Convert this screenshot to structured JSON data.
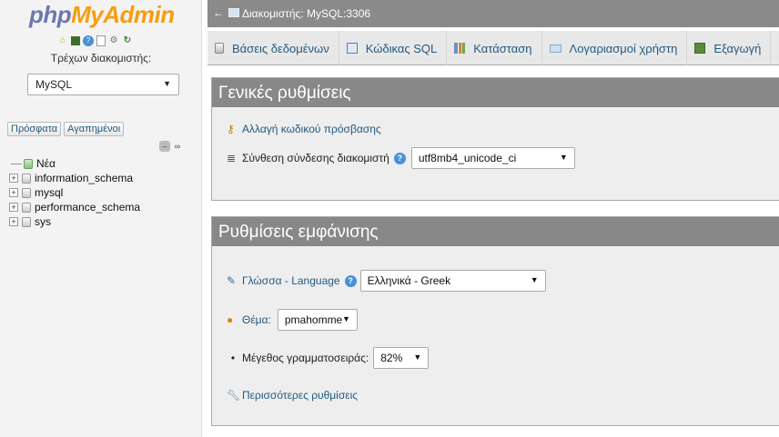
{
  "sidebar": {
    "logo_part1": "php",
    "logo_part2": "MyAdmin",
    "server_label": "Τρέχων διακομιστής:",
    "server_value": "MySQL",
    "recent_label": "Πρόσφατα",
    "favorites_label": "Αγαπημένοι",
    "tree": [
      {
        "label": "Νέα"
      },
      {
        "label": "information_schema"
      },
      {
        "label": "mysql"
      },
      {
        "label": "performance_schema"
      },
      {
        "label": "sys"
      }
    ]
  },
  "topbar": {
    "back_arrow": "←",
    "breadcrumb": "Διακομιστής: MySQL:3306"
  },
  "tabs": [
    {
      "label": "Βάσεις δεδομένων",
      "icon": "database-icon"
    },
    {
      "label": "Κώδικας SQL",
      "icon": "sql-icon"
    },
    {
      "label": "Κατάσταση",
      "icon": "status-icon"
    },
    {
      "label": "Λογαριασμοί χρήστη",
      "icon": "users-icon"
    },
    {
      "label": "Εξαγωγή",
      "icon": "export-icon"
    }
  ],
  "general": {
    "title": "Γενικές ρυθμίσεις",
    "change_password": "Αλλαγή κωδικού πρόσβασης",
    "collation_label": "Σύνθεση σύνδεσης διακομιστή",
    "collation_value": "utf8mb4_unicode_ci"
  },
  "appearance": {
    "title": "Ρυθμίσεις εμφάνισης",
    "language_label": "Γλώσσα - Language",
    "language_value": "Ελληνικά - Greek",
    "theme_label": "Θέμα:",
    "theme_value": "pmahomme",
    "font_size_label": "Μέγεθος γραμματοσειράς:",
    "font_size_value": "82%",
    "more_settings": "Περισσότερες ρυθμίσεις"
  },
  "colors": {
    "link": "#235a81",
    "header_gray": "#888888",
    "logo_blue": "#6c78af",
    "logo_orange": "#f89c0e"
  }
}
